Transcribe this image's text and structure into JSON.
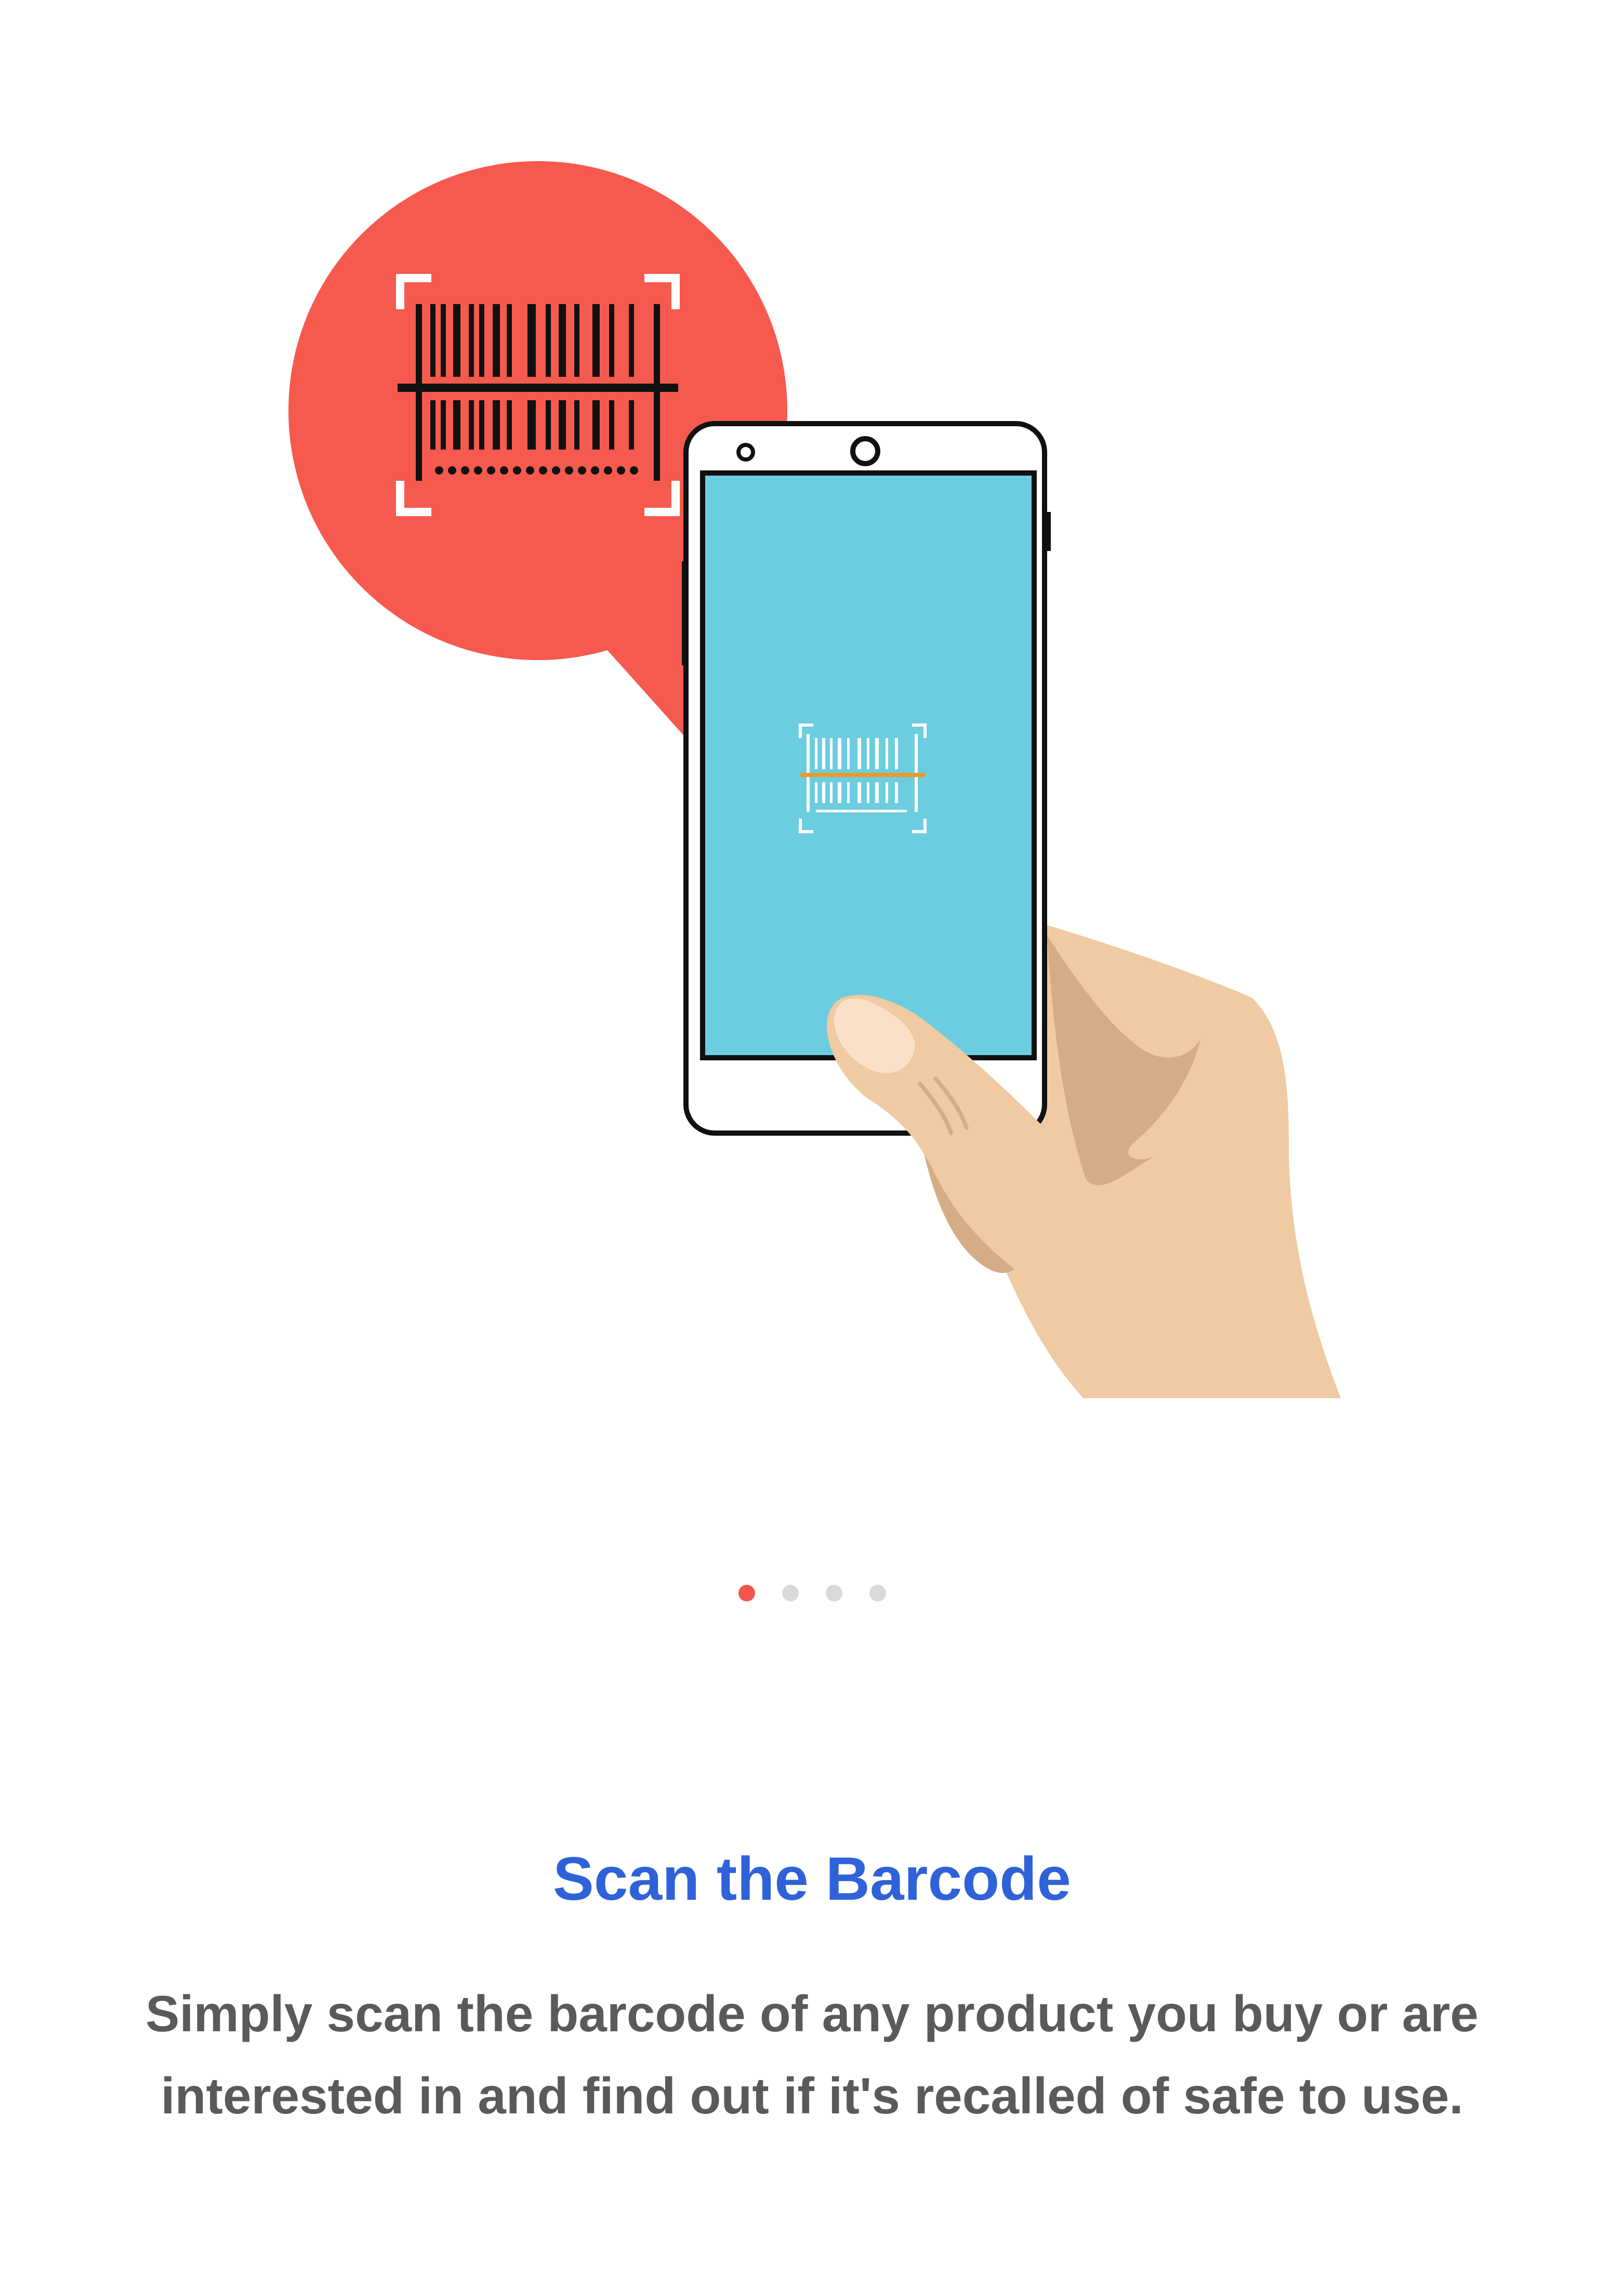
{
  "onboarding": {
    "illustration": {
      "icons": [
        "barcode-speech-bubble-icon",
        "phone-icon",
        "hand-icon",
        "barcode-scan-icon"
      ],
      "colors": {
        "bubble": "#f65a4e",
        "screen": "#6dcde0",
        "skin": "#efcaa3",
        "skin_shadow": "#d4ad87",
        "scan_line": "#e89a2c"
      }
    },
    "pager": {
      "count": 4,
      "active_index": 0,
      "active_color": "#f2574c",
      "inactive_color": "#d9d9d9"
    },
    "title": "Scan the Barcode",
    "description": "Simply scan the barcode of any product you buy or are interested in and find out if it's recalled of safe to use."
  }
}
